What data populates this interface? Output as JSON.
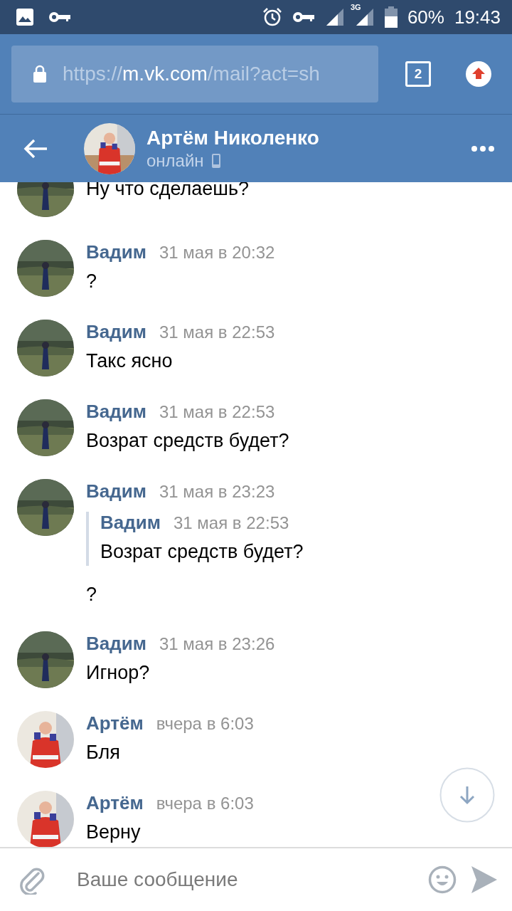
{
  "status_bar": {
    "battery": "60%",
    "time": "19:43",
    "network": "3G"
  },
  "browser": {
    "url_scheme": "https://",
    "url_host": "m.vk.com",
    "url_path": "/mail?act=sh",
    "tab_count": "2"
  },
  "header": {
    "name": "Артём Николенко",
    "status": "онлайн"
  },
  "messages": [
    {
      "kind": "partial",
      "avatar": {
        "kind": "field"
      },
      "text": "Ну что сделаешь?"
    },
    {
      "kind": "message",
      "avatar": {
        "kind": "field"
      },
      "author": "Вадим",
      "time": "31 мая в 20:32",
      "text": "?"
    },
    {
      "kind": "message",
      "avatar": {
        "kind": "field"
      },
      "author": "Вадим",
      "time": "31 мая в 22:53",
      "text": "Такс ясно"
    },
    {
      "kind": "message",
      "avatar": {
        "kind": "field"
      },
      "author": "Вадим",
      "time": "31 мая в 22:53",
      "text": "Возрат средств будет?"
    },
    {
      "kind": "message",
      "avatar": {
        "kind": "field"
      },
      "author": "Вадим",
      "time": "31 мая в 23:23",
      "quote": {
        "author": "Вадим",
        "time": "31 мая в 22:53",
        "text": "Возрат средств будет?"
      },
      "text": "?"
    },
    {
      "kind": "message",
      "avatar": {
        "kind": "field"
      },
      "author": "Вадим",
      "time": "31 мая в 23:26",
      "text": "Игнор?"
    },
    {
      "kind": "message",
      "avatar": {
        "kind": "red"
      },
      "author": "Артём",
      "time": "вчера в 6:03",
      "text": "Бля"
    },
    {
      "kind": "message",
      "avatar": {
        "kind": "red"
      },
      "author": "Артём",
      "time": "вчера в 6:03",
      "text": "Верну"
    }
  ],
  "composer": {
    "placeholder": "Ваше сообщение"
  }
}
